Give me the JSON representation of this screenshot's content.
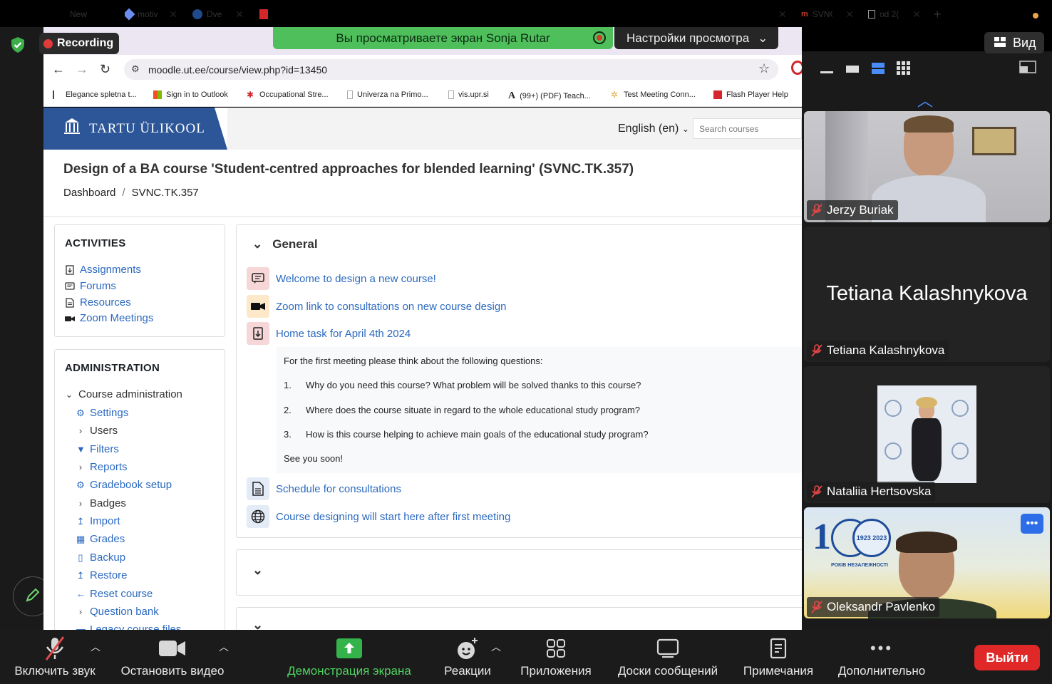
{
  "zoom": {
    "recording_label": "Recording",
    "share_banner": "Вы просматриваете экран Sonja Rutar",
    "view_settings": "Настройки просмотра",
    "view_button": "Вид"
  },
  "browser": {
    "tabs": [
      {
        "label": "New"
      },
      {
        "label": "motiv"
      },
      {
        "label": "Dve"
      },
      {
        "label": "SVNC"
      },
      {
        "label": "od 2("
      }
    ],
    "url": "moodle.ut.ee/course/view.php?id=13450",
    "bookmarks": [
      "Elegance spletna t...",
      "Sign in to Outlook",
      "Occupational Stre...",
      "Univerza na Primo...",
      "vis.upr.si",
      "(99+) (PDF) Teach...",
      "Test Meeting Conn...",
      "Flash Player Help"
    ]
  },
  "moodle": {
    "university": "TARTU ÜLIKOOL",
    "language": "English (en)",
    "search_placeholder": "Search courses",
    "course_title": "Design of a BA course 'Student-centred approaches for blended learning' (SVNC.TK.357)",
    "breadcrumb": [
      "Dashboard",
      "SVNC.TK.357"
    ],
    "activities": {
      "title": "ACTIVITIES",
      "items": [
        "Assignments",
        "Forums",
        "Resources",
        "Zoom Meetings"
      ]
    },
    "administration": {
      "title": "ADMINISTRATION",
      "course_admin": "Course administration",
      "items": [
        "Settings",
        "Users",
        "Filters",
        "Reports",
        "Gradebook setup",
        "Badges",
        "Import",
        "Grades",
        "Backup",
        "Restore",
        "Reset course",
        "Question bank",
        "Legacy course files"
      ]
    },
    "section": {
      "title": "General",
      "modules": [
        "Welcome to design a new course!",
        "Zoom link to consultations on new course design",
        "Home task for April 4th 2024",
        "Schedule for consultations",
        "Course designing will start here after first meeting"
      ],
      "task_intro": "For the first meeting please think about the following questions:",
      "questions": [
        "Why do you need this course? What problem will be solved thanks to this course?",
        "Where does the course situate in regard to the whole educational study program?",
        "How is this course helping to achieve main goals of the educational study program?"
      ],
      "question_numbers": [
        "1.",
        "2.",
        "3."
      ],
      "task_outro": "See you soon!"
    }
  },
  "participants": [
    {
      "name": "Jerzy Buriak"
    },
    {
      "name": "Tetiana Kalashnykova",
      "display": "Tetiana Kalashnykova"
    },
    {
      "name": "Nataliia Hertsovska"
    },
    {
      "name": "Oleksandr Pavlenko"
    }
  ],
  "toolbar": {
    "unmute": "Включить звук",
    "stop_video": "Остановить видео",
    "share": "Демонстрация экрана",
    "reactions": "Реакции",
    "apps": "Приложения",
    "whiteboards": "Доски сообщений",
    "notes": "Примечания",
    "more": "Дополнительно",
    "leave": "Выйти"
  },
  "badge_text": {
    "years": "1923 2023",
    "motto": "РОКІВ НЕЗАЛЕЖНОСТІ"
  }
}
